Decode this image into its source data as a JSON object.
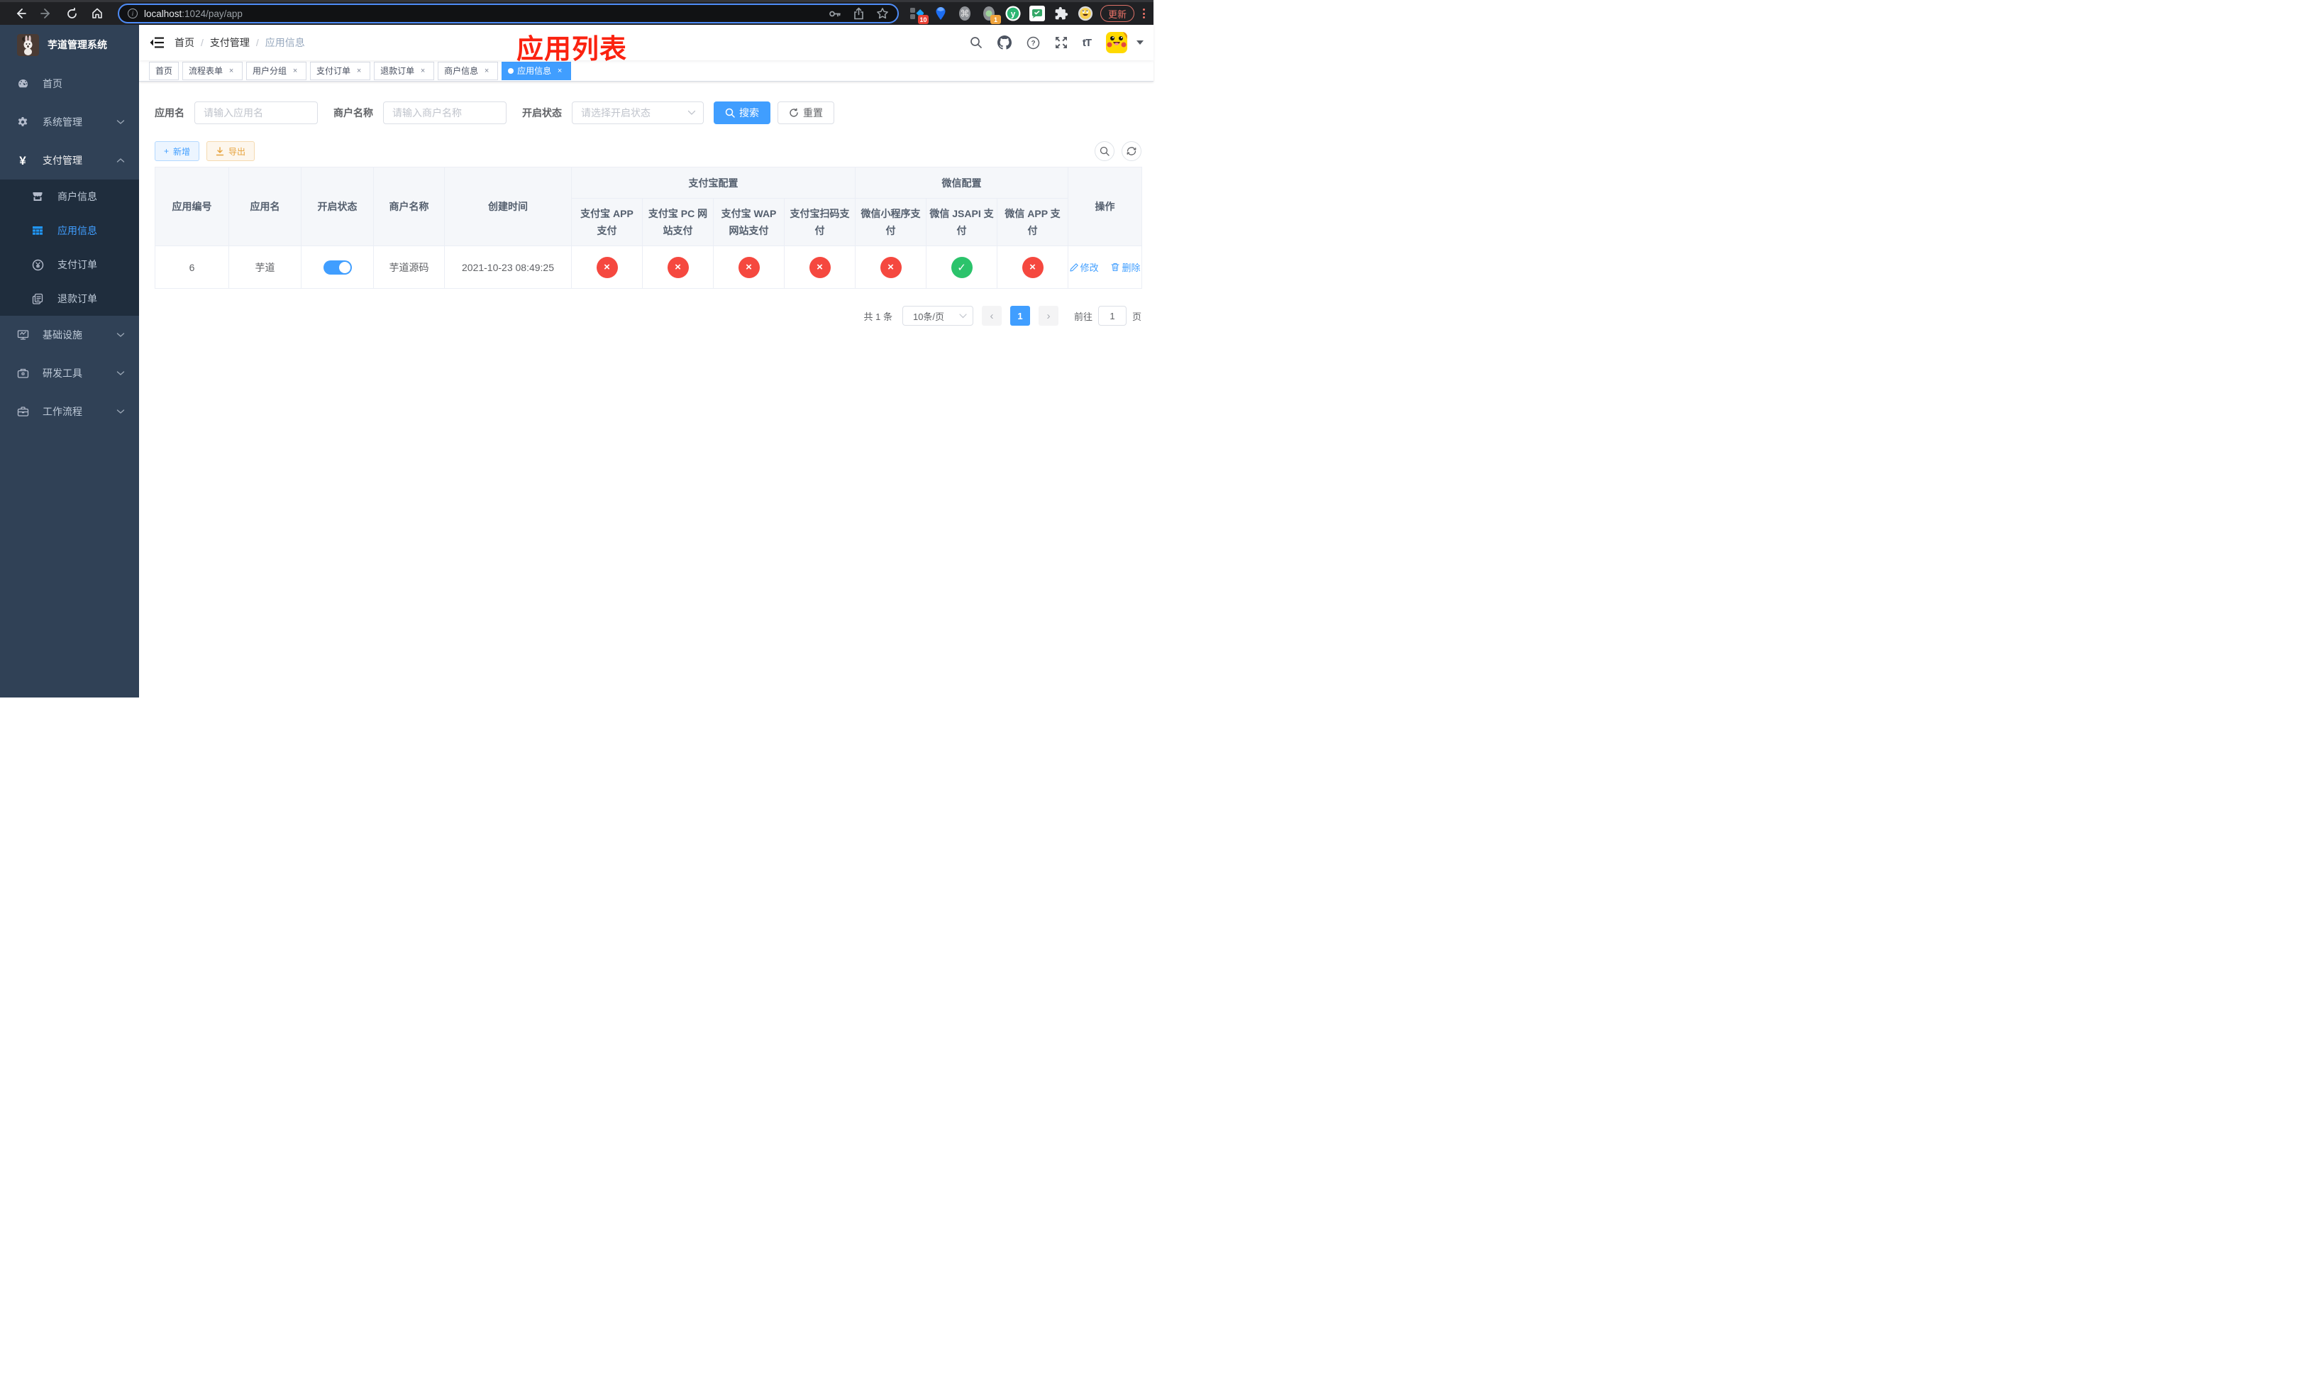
{
  "colors": {
    "accent": "#409eff",
    "danger": "#f5483f",
    "success": "#2bc36b",
    "sidebar_bg": "#304156",
    "submenu_bg": "#1f2d3d",
    "title_red": "#fb2210"
  },
  "browser": {
    "url_host": "localhost",
    "url_rest": ":1024/pay/app",
    "info_glyph": "i",
    "update_label": "更新",
    "ext_badge_1": "10",
    "ext_badge_2": "1",
    "cmd_glyph": "⌘",
    "y_glyph": "y"
  },
  "sidebar": {
    "title": "芋道管理系统",
    "items": [
      {
        "label": "首页"
      },
      {
        "label": "系统管理"
      },
      {
        "label": "支付管理"
      },
      {
        "label": "基础设施"
      },
      {
        "label": "研发工具"
      },
      {
        "label": "工作流程"
      }
    ],
    "submenu": [
      {
        "label": "商户信息"
      },
      {
        "label": "应用信息",
        "active": true
      },
      {
        "label": "支付订单"
      },
      {
        "label": "退款订单"
      }
    ],
    "yen_glyph": "¥"
  },
  "navbar": {
    "breadcrumb": [
      "首页",
      "支付管理",
      "应用信息"
    ],
    "separator": "/",
    "title_annotation": "应用列表",
    "text_size_glyph": "tT"
  },
  "tags": {
    "items": [
      {
        "label": "首页"
      },
      {
        "label": "流程表单"
      },
      {
        "label": "用户分组"
      },
      {
        "label": "支付订单"
      },
      {
        "label": "退款订单"
      },
      {
        "label": "商户信息"
      },
      {
        "label": "应用信息",
        "active": true
      }
    ],
    "close_glyph": "×"
  },
  "filters": {
    "app_name_label": "应用名",
    "app_name_placeholder": "请输入应用名",
    "merchant_label": "商户名称",
    "merchant_placeholder": "请输入商户名称",
    "status_label": "开启状态",
    "status_placeholder": "请选择开启状态",
    "search_label": "搜索",
    "reset_label": "重置"
  },
  "actions": {
    "add_label": "新增",
    "export_label": "导出",
    "add_plus": "+"
  },
  "table": {
    "groups": {
      "alipay": "支付宝配置",
      "wechat": "微信配置"
    },
    "columns": [
      "应用编号",
      "应用名",
      "开启状态",
      "商户名称",
      "创建时间",
      "支付宝 APP 支付",
      "支付宝 PC 网站支付",
      "支付宝 WAP 网站支付",
      "支付宝扫码支付",
      "微信小程序支付",
      "微信 JSAPI 支付",
      "微信 APP 支付",
      "操作"
    ],
    "row": {
      "id": "6",
      "name": "芋道",
      "enabled": true,
      "merchant": "芋道源码",
      "created": "2021-10-23 08:49:25",
      "statuses": [
        "disabled",
        "disabled",
        "disabled",
        "disabled",
        "disabled",
        "enabled",
        "disabled"
      ],
      "status_glyphs": [
        "×",
        "×",
        "×",
        "×",
        "×",
        "✓",
        "×"
      ],
      "edit_label": "修改",
      "delete_label": "删除"
    }
  },
  "pagination": {
    "total": "共 1 条",
    "page_size": "10条/页",
    "prev_glyph": "‹",
    "next_glyph": "›",
    "current_page": "1",
    "goto_prefix": "前往",
    "goto_value": "1",
    "goto_suffix": "页"
  }
}
